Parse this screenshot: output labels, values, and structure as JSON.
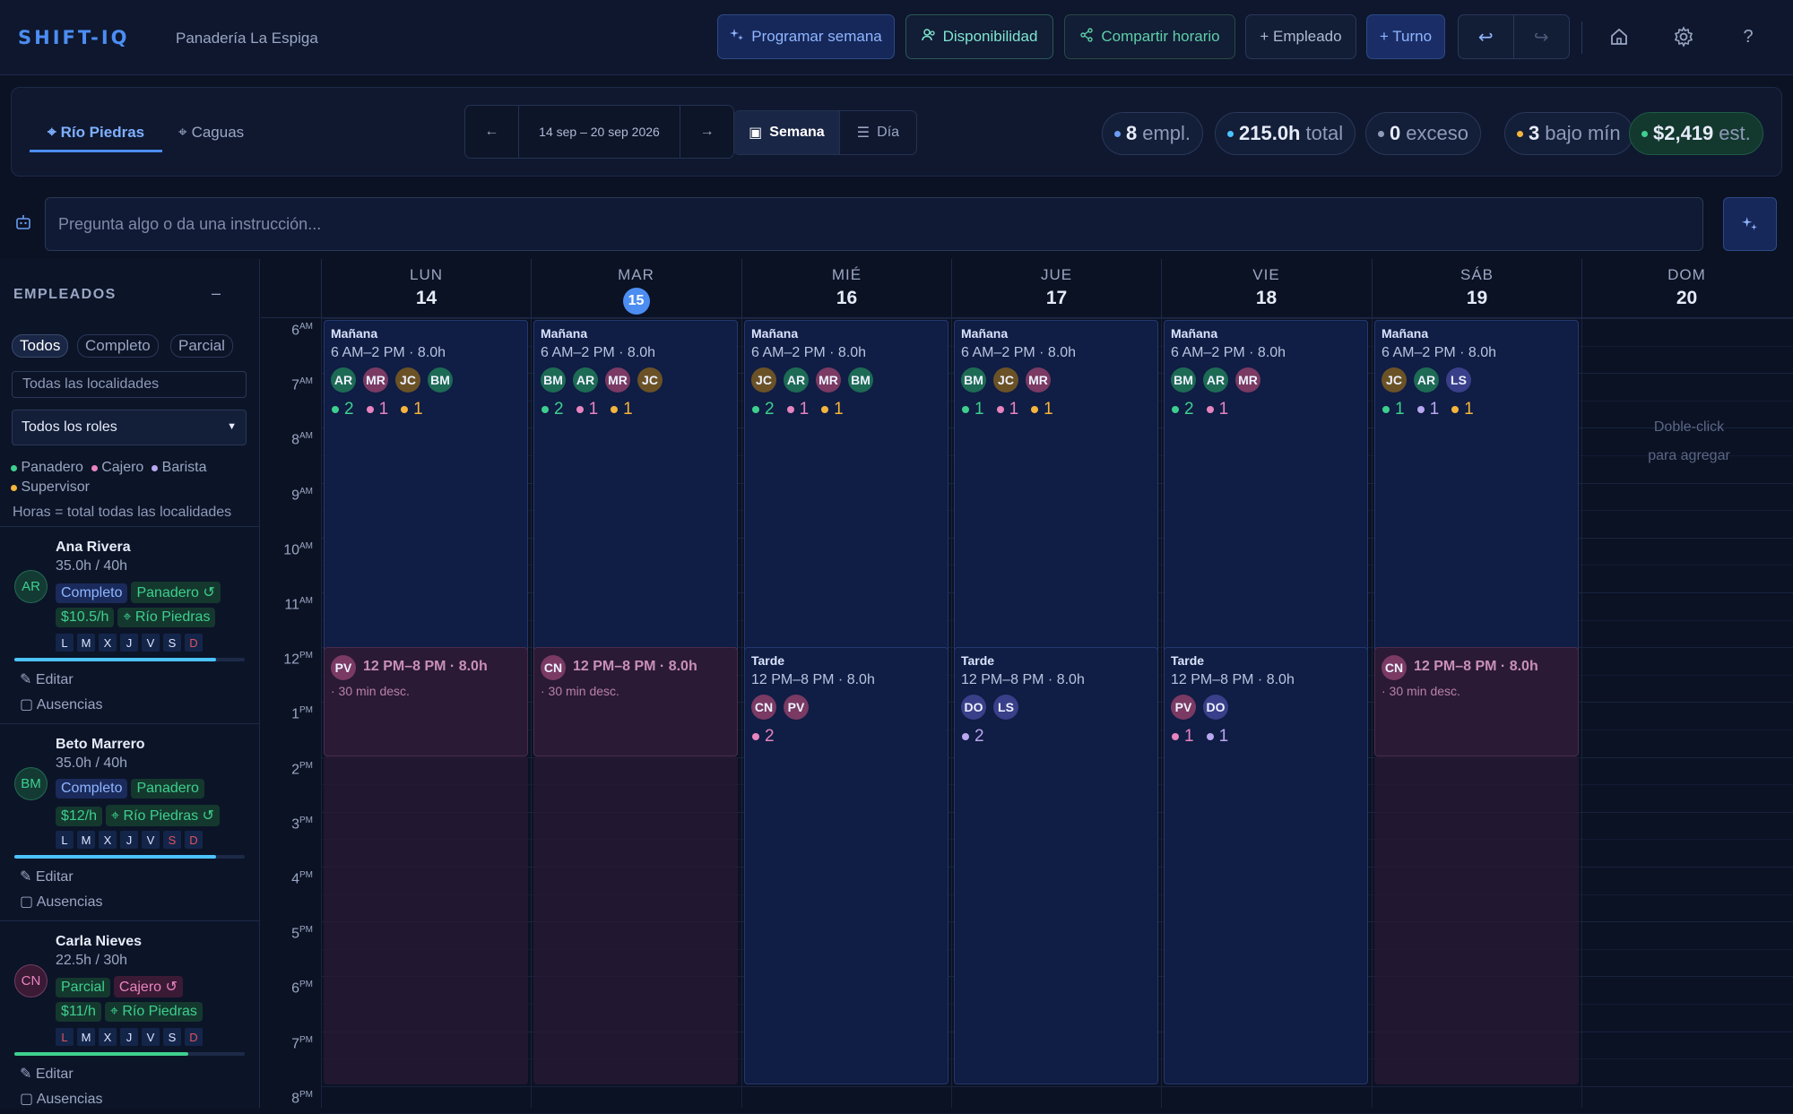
{
  "app": {
    "logo": "SHIFT-IQ",
    "business": "Panadería La Espiga"
  },
  "toolbar": {
    "programar": "Programar semana",
    "disponibilidad": "Disponibilidad",
    "compartir": "Compartir horario",
    "empleado": "+ Empleado",
    "turno": "+ Turno"
  },
  "locations": {
    "active": "Río Piedras",
    "other": "Caguas"
  },
  "dateNav": {
    "prev": "←",
    "range": "14 sep – 20 sep 2026",
    "next": "→"
  },
  "view": {
    "semana": "Semana",
    "dia": "Día"
  },
  "stats": {
    "empl_n": "8",
    "empl_l": "empl.",
    "total_n": "215.0h",
    "total_l": "total",
    "exceso_n": "0",
    "exceso_l": "exceso",
    "bajo_n": "3",
    "bajo_l": "bajo mín",
    "est_n": "$2,419",
    "est_l": "est."
  },
  "ask": {
    "placeholder": "Pregunta algo o da una instrucción..."
  },
  "sidebar": {
    "title": "EMPLEADOS",
    "collapse": "–",
    "filters": [
      "Todos",
      "Completo",
      "Parcial"
    ],
    "locFilter": "Todas las localidades",
    "roleFilter": "Todos los roles",
    "legend": [
      "Panadero",
      "Cajero",
      "Barista",
      "Supervisor"
    ],
    "note": "Horas = total todas las localidades",
    "employees": [
      {
        "initials": "AR",
        "name": "Ana Rivera",
        "hours": "35.0h / 40h",
        "type": "Completo",
        "role": "Panadero ↺",
        "rate": "$10.5/h",
        "loc": "Río Piedras",
        "edit": "Editar",
        "abs": "Ausencias"
      },
      {
        "initials": "BM",
        "name": "Beto Marrero",
        "hours": "35.0h / 40h",
        "type": "Completo",
        "role": "Panadero",
        "rate": "$12/h",
        "loc": "Río Piedras ↺",
        "edit": "Editar",
        "abs": "Ausencias"
      },
      {
        "initials": "CN",
        "name": "Carla Nieves",
        "hours": "22.5h / 30h",
        "type": "Parcial",
        "role": "Cajero ↺",
        "rate": "$11/h",
        "loc": "Río Piedras",
        "edit": "Editar",
        "abs": "Ausencias"
      }
    ],
    "dayLetters": [
      "L",
      "M",
      "X",
      "J",
      "V",
      "S",
      "D"
    ]
  },
  "calendar": {
    "days": [
      {
        "name": "LUN",
        "num": "14"
      },
      {
        "name": "MAR",
        "num": "15"
      },
      {
        "name": "MIÉ",
        "num": "16"
      },
      {
        "name": "JUE",
        "num": "17"
      },
      {
        "name": "VIE",
        "num": "18"
      },
      {
        "name": "SÁB",
        "num": "19"
      },
      {
        "name": "DOM",
        "num": "20"
      }
    ],
    "hours": [
      [
        "6",
        "AM"
      ],
      [
        "7",
        "AM"
      ],
      [
        "8",
        "AM"
      ],
      [
        "9",
        "AM"
      ],
      [
        "10",
        "AM"
      ],
      [
        "11",
        "AM"
      ],
      [
        "12",
        "PM"
      ],
      [
        "1",
        "PM"
      ],
      [
        "2",
        "PM"
      ],
      [
        "3",
        "PM"
      ],
      [
        "4",
        "PM"
      ],
      [
        "5",
        "PM"
      ],
      [
        "6",
        "PM"
      ],
      [
        "7",
        "PM"
      ],
      [
        "8",
        "PM"
      ]
    ],
    "morning": {
      "title": "Mañana",
      "time": "6 AM–2 PM · 8.0h"
    },
    "afternoon": {
      "title": "Tarde",
      "time": "12 PM–8 PM · 8.0h",
      "desc": "· 30 min desc."
    },
    "empty": {
      "line1": "Doble-click",
      "line2": "para agregar"
    },
    "morningChips": [
      [
        "AR",
        "MR",
        "JC",
        "BM"
      ],
      [
        "BM",
        "AR",
        "MR",
        "JC"
      ],
      [
        "JC",
        "AR",
        "MR",
        "BM"
      ],
      [
        "BM",
        "JC",
        "MR"
      ],
      [
        "BM",
        "AR",
        "MR"
      ],
      [
        "JC",
        "AR",
        "LS"
      ]
    ],
    "morningCounts": [
      [
        [
          "#3ecf8e",
          "2"
        ],
        [
          "#e884c0",
          "1"
        ],
        [
          "#f5b43c",
          "1"
        ]
      ],
      [
        [
          "#3ecf8e",
          "2"
        ],
        [
          "#e884c0",
          "1"
        ],
        [
          "#f5b43c",
          "1"
        ]
      ],
      [
        [
          "#3ecf8e",
          "2"
        ],
        [
          "#e884c0",
          "1"
        ],
        [
          "#f5b43c",
          "1"
        ]
      ],
      [
        [
          "#3ecf8e",
          "1"
        ],
        [
          "#e884c0",
          "1"
        ],
        [
          "#f5b43c",
          "1"
        ]
      ],
      [
        [
          "#3ecf8e",
          "2"
        ],
        [
          "#e884c0",
          "1"
        ]
      ],
      [
        [
          "#3ecf8e",
          "1"
        ],
        [
          "#b8a8f0",
          "1"
        ],
        [
          "#f5b43c",
          "1"
        ]
      ]
    ],
    "afternoonSingle": {
      "0": "PV",
      "1": "CN",
      "5": "CN"
    },
    "afternoonChips": {
      "2": [
        "CN",
        "PV"
      ],
      "3": [
        "DO",
        "LS"
      ],
      "4": [
        "PV",
        "DO"
      ]
    },
    "afternoonCounts": {
      "2": [
        [
          "#e884c0",
          "2"
        ]
      ],
      "3": [
        [
          "#b8a8f0",
          "2"
        ]
      ],
      "4": [
        [
          "#e884c0",
          "1"
        ],
        [
          "#b8a8f0",
          "1"
        ]
      ]
    }
  },
  "colors": {
    "AR": "#1d6b55",
    "MR": "#7a3a63",
    "JC": "#6b5226",
    "BM": "#1d6b55",
    "LS": "#3a3f8a",
    "CN": "#7a3a63",
    "PV": "#7a3a63",
    "DO": "#3a3f8a"
  }
}
